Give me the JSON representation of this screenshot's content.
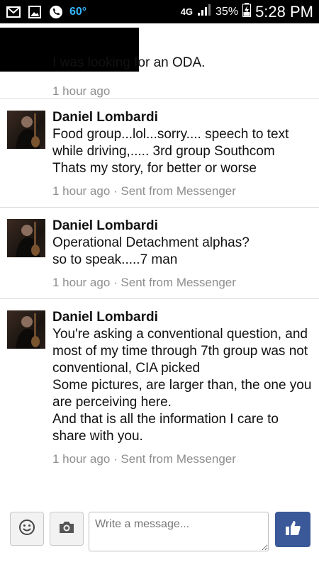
{
  "statusbar": {
    "temperature": "60°",
    "network": "4G",
    "battery": "35%",
    "time": "5:28 PM"
  },
  "messages": [
    {
      "sender": "",
      "text": "I was looking for an ODA.",
      "meta": "1 hour ago"
    },
    {
      "sender": "Daniel Lombardi",
      "text": "Food group...lol...sorry.... speech to text while driving,..... 3rd group Southcom\nThats my story, for better or worse",
      "meta": "1 hour ago · Sent from Messenger"
    },
    {
      "sender": "Daniel Lombardi",
      "text": "Operational Detachment alphas?\nso to speak.....7 man",
      "meta": "1 hour ago · Sent from Messenger"
    },
    {
      "sender": "Daniel Lombardi",
      "text": "You're asking a conventional question, and most of my time through 7th group was not conventional, CIA picked\nSome pictures, are larger than, the one you are perceiving here.\nAnd that is all the information I care to share with you.",
      "meta": "1 hour ago · Sent from Messenger"
    }
  ],
  "composer": {
    "placeholder": "Write a message..."
  },
  "icons": {
    "status_left": [
      "mail-icon",
      "image-icon",
      "phone-icon"
    ],
    "composer": [
      "smiley-icon",
      "camera-icon",
      "like-icon"
    ]
  },
  "colors": {
    "like_button": "#3b5998",
    "temperature": "#34b6ff",
    "meta_text": "#8e8e8e"
  }
}
